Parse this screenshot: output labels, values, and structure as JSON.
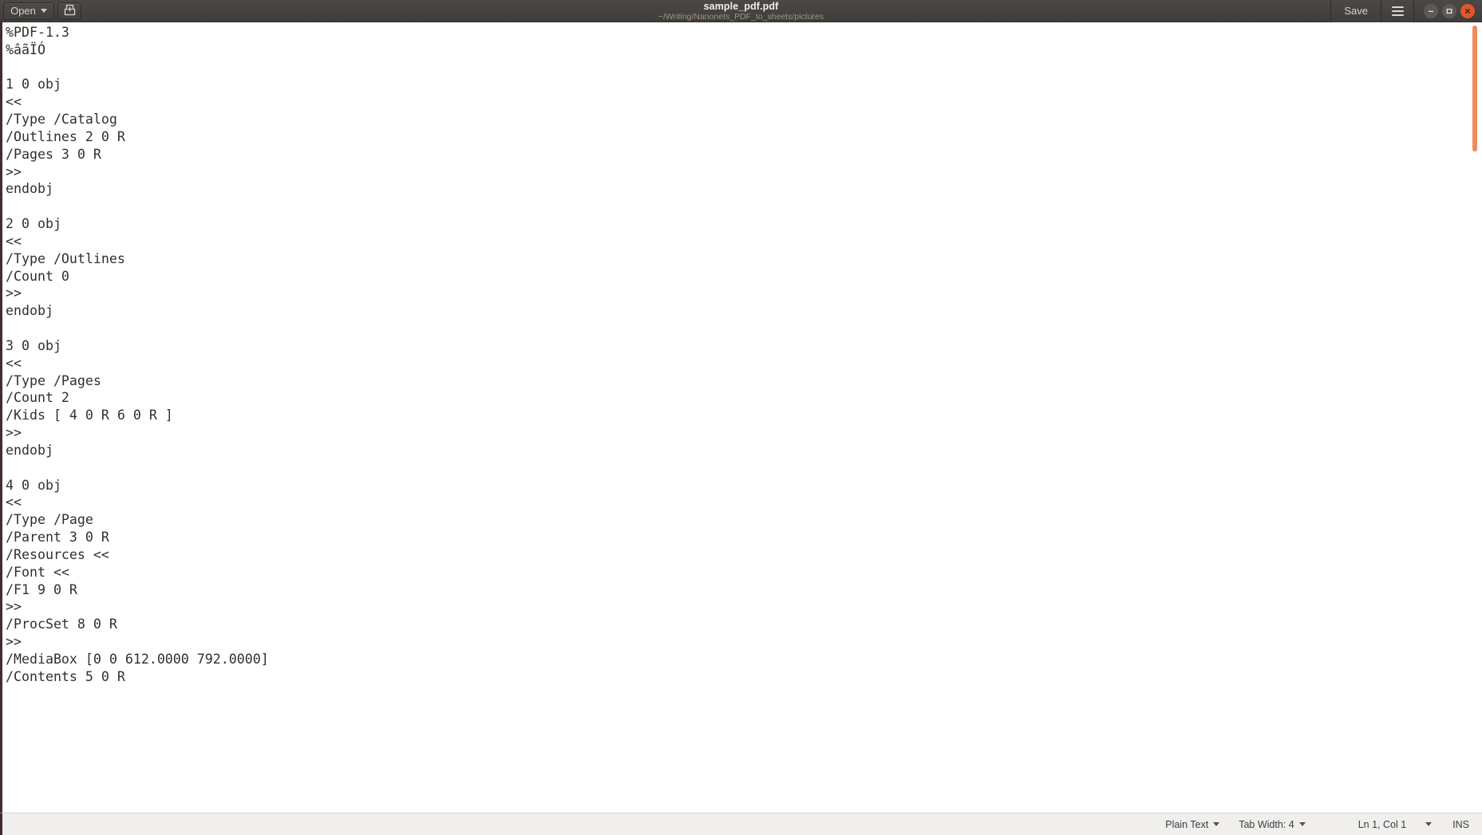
{
  "window": {
    "title": "sample_pdf.pdf",
    "subtitle": "~/Writing/Nanonets_PDF_to_sheets/pictures"
  },
  "toolbar": {
    "open_label": "Open",
    "open_icon": "chevron-down-icon",
    "new_doc_icon": "save-as-icon",
    "save_label": "Save",
    "menu_icon": "hamburger-menu-icon",
    "minimize_icon": "minimize-icon",
    "maximize_icon": "maximize-icon",
    "close_icon": "close-icon"
  },
  "colors": {
    "titlebar_bg": "#45423f",
    "accent_scrollbar": "#f08a5d",
    "close_button": "#e2562a",
    "editor_text": "#30302e",
    "editor_bg": "#ffffff",
    "statusbar_bg": "#f0efee",
    "left_border": "#402d33"
  },
  "editor": {
    "content": "%PDF-1.3\n%âãÏÓ\n\n1 0 obj\n<<\n/Type /Catalog\n/Outlines 2 0 R\n/Pages 3 0 R\n>>\nendobj\n\n2 0 obj\n<<\n/Type /Outlines\n/Count 0\n>>\nendobj\n\n3 0 obj\n<<\n/Type /Pages\n/Count 2\n/Kids [ 4 0 R 6 0 R ]\n>>\nendobj\n\n4 0 obj\n<<\n/Type /Page\n/Parent 3 0 R\n/Resources <<\n/Font <<\n/F1 9 0 R\n>>\n/ProcSet 8 0 R\n>>\n/MediaBox [0 0 612.0000 792.0000]\n/Contents 5 0 R"
  },
  "statusbar": {
    "language": "Plain Text",
    "tab_width": "Tab Width: 4",
    "cursor_position": "Ln 1, Col 1",
    "insert_mode": "INS"
  }
}
